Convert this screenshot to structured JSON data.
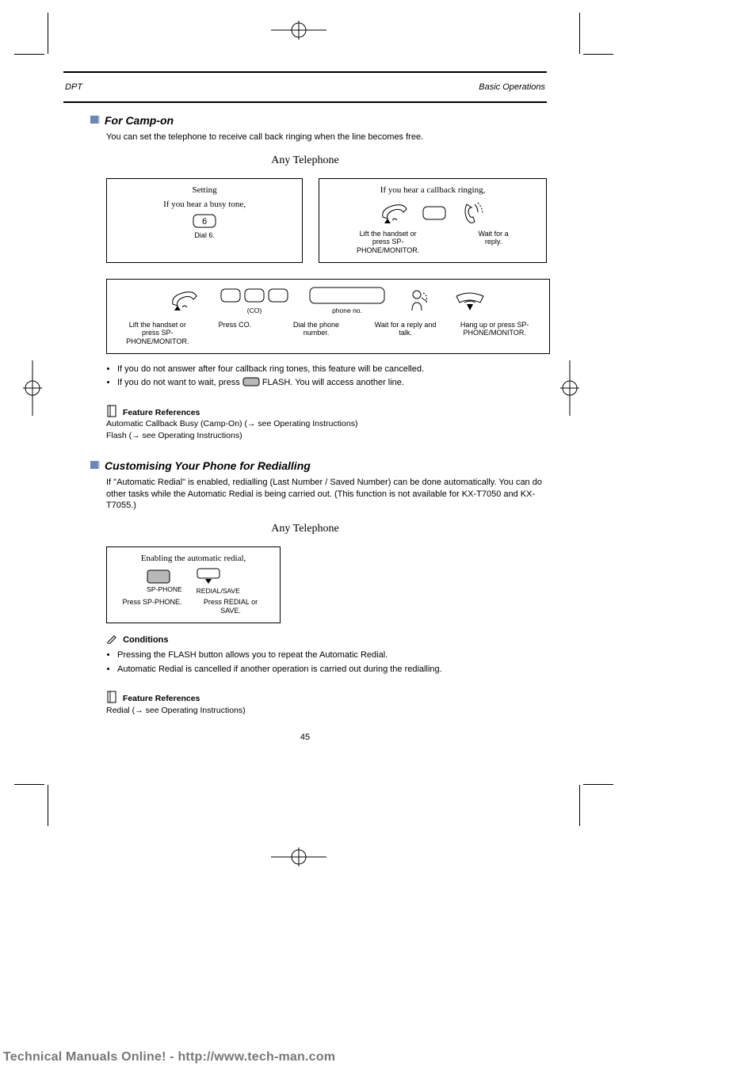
{
  "head": {
    "left": "DPT",
    "right": "Basic Operations"
  },
  "feature1": {
    "title": "For Camp-on",
    "lead": "You can set the telephone to receive call back ringing when the line becomes free.",
    "caption_any": "Any Telephone",
    "caption_setting": "Setting",
    "caption_if_busy": "If you hear a busy tone,",
    "caption_if_ring": "If you hear a callback ringing,",
    "keys": {
      "digit6": "6",
      "lift": "Lift the handset or press SP-PHONE/MONITOR.",
      "dial6": "Dial 6.",
      "wait": "Wait for a reply.",
      "hangup": "Hang up or press SP-PHONE/MONITOR.",
      "co": "(CO)",
      "phoneno": "phone no.",
      "co_press": "Press CO.",
      "dial_phone": "Dial the phone number.",
      "reply": "Wait for a reply and talk."
    },
    "cond_bullets": [
      "If you do not answer after four callback ring tones, this feature will be cancelled."
    ],
    "cond_cancel_prefix": "If you do not want to wait, press ",
    "cond_cancel_link": "FLASH.",
    "cond_cancel_suffix": " You will access another line.",
    "refs_header": "Feature References",
    "refs_1": "Automatic Callback Busy (Camp-On) (→ see Operating Instructions)",
    "refs_2": "Flash (→ see Operating Instructions)"
  },
  "feature2": {
    "title": "Customising Your Phone for Redialling",
    "lead": "If \"Automatic Redial\" is enabled, redialling (Last Number / Saved Number) can be done automatically. You can do other tasks while the Automatic Redial is being carried out. (This function is not available for KX-T7050 and KX-T7055.)",
    "caption_any": "Any Telephone",
    "caption_enable": "Enabling the automatic redial,",
    "keys": {
      "sp": "SP-PHONE",
      "redial": "REDIAL/SAVE",
      "sp_press": "Press SP-PHONE.",
      "redial_press": "Press REDIAL or SAVE."
    },
    "cond_header": "Conditions",
    "cond_bullets": [
      "Pressing the FLASH button allows you to repeat the Automatic Redial.",
      "Automatic Redial is cancelled if another operation is carried out during the redialling."
    ],
    "refs_header": "Feature References",
    "refs_1": "Redial (→ see Operating Instructions)"
  },
  "page_number": "45",
  "footer": "Technical Manuals Online! - http://www.tech-man.com"
}
